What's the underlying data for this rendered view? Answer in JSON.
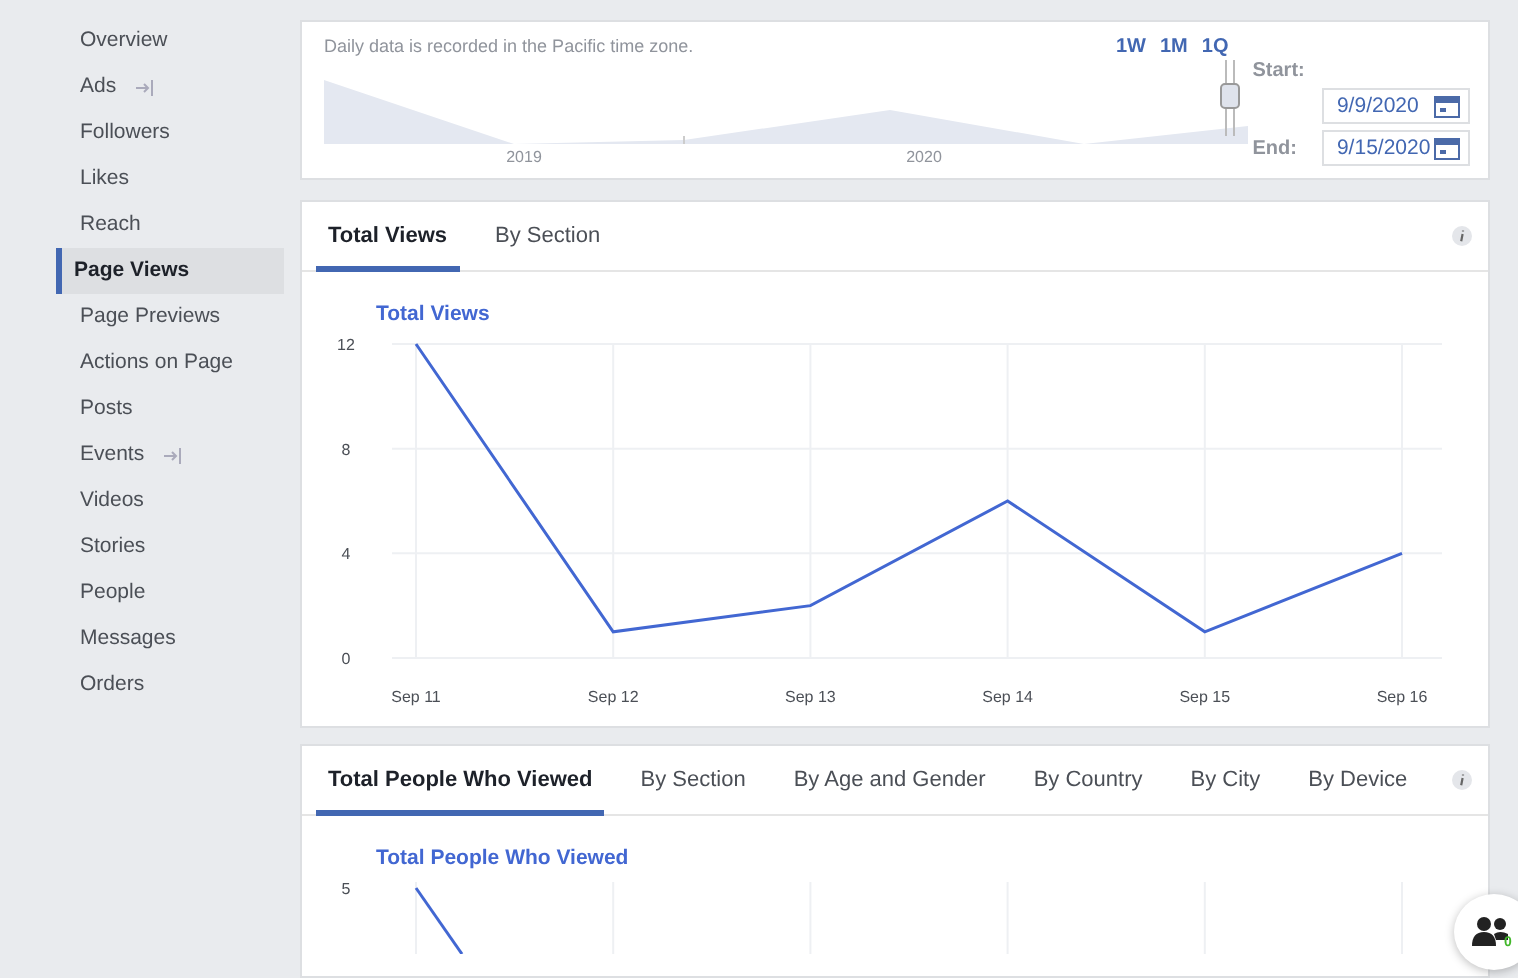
{
  "sidebar": {
    "items": [
      {
        "label": "Overview",
        "selected": false,
        "has_icon": false
      },
      {
        "label": "Ads",
        "selected": false,
        "has_icon": true
      },
      {
        "label": "Followers",
        "selected": false,
        "has_icon": false
      },
      {
        "label": "Likes",
        "selected": false,
        "has_icon": false
      },
      {
        "label": "Reach",
        "selected": false,
        "has_icon": false
      },
      {
        "label": "Page Views",
        "selected": true,
        "has_icon": false
      },
      {
        "label": "Page Previews",
        "selected": false,
        "has_icon": false
      },
      {
        "label": "Actions on Page",
        "selected": false,
        "has_icon": false
      },
      {
        "label": "Posts",
        "selected": false,
        "has_icon": false
      },
      {
        "label": "Events",
        "selected": false,
        "has_icon": true
      },
      {
        "label": "Videos",
        "selected": false,
        "has_icon": false
      },
      {
        "label": "Stories",
        "selected": false,
        "has_icon": false
      },
      {
        "label": "People",
        "selected": false,
        "has_icon": false
      },
      {
        "label": "Messages",
        "selected": false,
        "has_icon": false
      },
      {
        "label": "Orders",
        "selected": false,
        "has_icon": false
      }
    ]
  },
  "date_range": {
    "note": "Daily data is recorded in the Pacific time zone.",
    "timeline_labels": [
      "2019",
      "2020"
    ],
    "presets": [
      "1W",
      "1M",
      "1Q"
    ],
    "start_label": "Start:",
    "start_value": "9/9/2020",
    "end_label": "End:",
    "end_value": "9/15/2020"
  },
  "views_panel": {
    "tabs": [
      {
        "label": "Total Views",
        "selected": true
      },
      {
        "label": "By Section",
        "selected": false
      }
    ],
    "chart_data": {
      "type": "line",
      "grid": true,
      "categories": [
        "Sep 11",
        "Sep 12",
        "Sep 13",
        "Sep 14",
        "Sep 15",
        "Sep 16"
      ],
      "series": [
        {
          "name": "Total Views",
          "color": "#4267d2",
          "values": [
            12,
            1,
            2,
            6,
            1,
            4
          ]
        }
      ],
      "yticks": [
        0,
        4,
        8,
        12
      ],
      "ylim": [
        0,
        12
      ]
    }
  },
  "people_panel": {
    "tabs": [
      {
        "label": "Total People Who Viewed",
        "selected": true
      },
      {
        "label": "By Section",
        "selected": false
      },
      {
        "label": "By Age and Gender",
        "selected": false
      },
      {
        "label": "By Country",
        "selected": false
      },
      {
        "label": "By City",
        "selected": false
      },
      {
        "label": "By Device",
        "selected": false
      }
    ],
    "chart_title": "Total People Who Viewed",
    "ytick_labels": [
      "5"
    ]
  },
  "chat_button": {
    "count": "0"
  }
}
